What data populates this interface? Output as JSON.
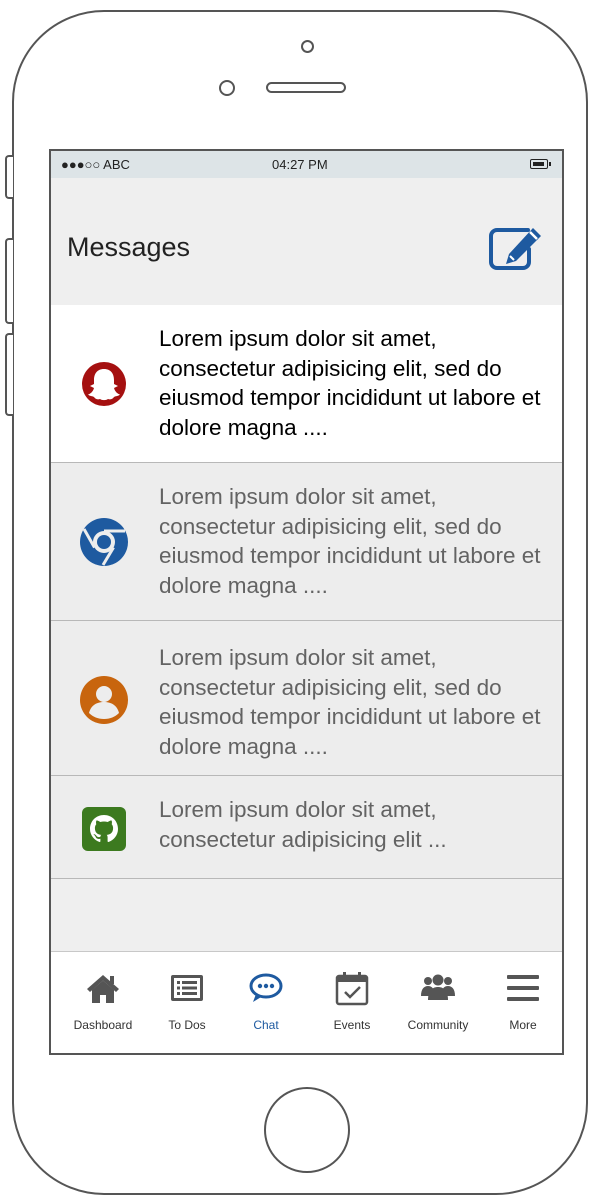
{
  "status_bar": {
    "carrier": "●●●○○ ABC",
    "time": "04:27 PM"
  },
  "header": {
    "title": "Messages"
  },
  "messages": [
    {
      "icon": "snapchat-icon",
      "icon_color": "#a51010",
      "text": "Lorem ipsum dolor sit amet, consectetur adipisicing elit, sed do eiusmod tempor incididunt ut labore et dolore magna ....",
      "state": "active"
    },
    {
      "icon": "chrome-icon",
      "icon_color": "#1e5aa0",
      "text": "Lorem ipsum dolor sit amet, consectetur adipisicing elit, sed do eiusmod tempor incididunt ut labore et dolore magna ....",
      "state": "inactive"
    },
    {
      "icon": "user-icon",
      "icon_color": "#c8650e",
      "text": "Lorem ipsum dolor sit amet, consectetur adipisicing elit, sed do eiusmod tempor incididunt ut labore et dolore magna ....",
      "state": "inactive"
    },
    {
      "icon": "github-icon",
      "icon_color": "#3c7a1f",
      "text": "Lorem ipsum dolor sit amet, consectetur adipisicing elit ...",
      "state": "inactive"
    }
  ],
  "tabs": [
    {
      "label": "Dashboard",
      "icon": "home-icon"
    },
    {
      "label": "To Dos",
      "icon": "list-icon"
    },
    {
      "label": "Chat",
      "icon": "chat-icon",
      "active": true
    },
    {
      "label": "Events",
      "icon": "calendar-check-icon"
    },
    {
      "label": "Community",
      "icon": "users-icon"
    },
    {
      "label": "More",
      "icon": "menu-icon"
    }
  ],
  "colors": {
    "accent": "#1e5aa0",
    "status_bar_bg": "#dde4e7",
    "screen_bg": "#efefef"
  }
}
